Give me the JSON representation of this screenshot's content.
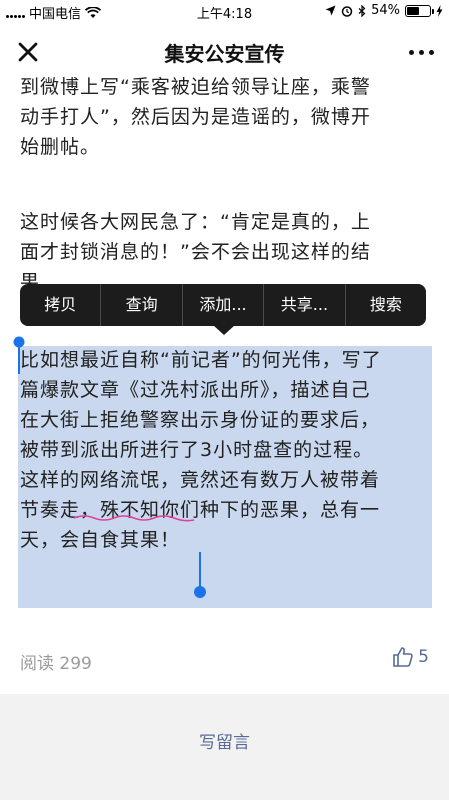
{
  "status_bar": {
    "carrier": "中国电信",
    "time": "上午4:18",
    "battery_percent": "54%",
    "battery_level": 0.54
  },
  "nav": {
    "title": "集安公安宣传"
  },
  "article": {
    "para1": [
      "到微博上写“乘客被迫给领导让座，乘警",
      "动手打人”，然后因为是造谣的，微博开",
      "始删帖。"
    ],
    "para2": [
      "这时候各大网民急了：“肯定是真的，上",
      "面才封锁消息的！”会不会出现这样的结",
      "果"
    ],
    "para3": [
      "比如想最近自称“前记者”的何光伟，写了",
      "篇爆款文章《过冼村派出所》，描述自己",
      "在大街上拒绝警察出示身份证的要求后，",
      "被带到派出所进行了3小时盘查的过程。",
      "这样的网络流氓，竟然还有数万人被带着",
      "节奏走，殊不知你们种下的恶果，总有一",
      "天，会自食其果！"
    ]
  },
  "context_menu": {
    "items": [
      "拷贝",
      "查询",
      "添加...",
      "共享...",
      "搜索"
    ]
  },
  "footer": {
    "read_label": "阅读 299",
    "like_count": "5",
    "comment_button": "写留言"
  },
  "colors": {
    "link": "#576b95",
    "selection": "#c9d8ee",
    "handle": "#1a73e8"
  }
}
